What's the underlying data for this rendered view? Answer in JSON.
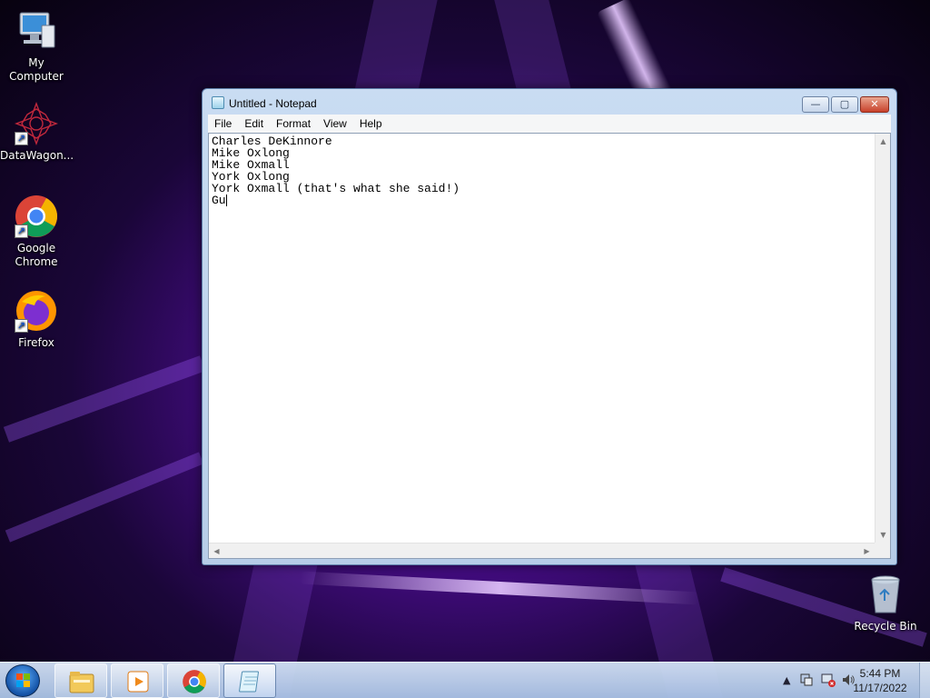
{
  "desktop": {
    "icons": [
      {
        "label": "My Computer",
        "icon": "computer-icon"
      },
      {
        "label": "DataWagon...",
        "icon": "datawagon-icon"
      },
      {
        "label": "Google Chrome",
        "icon": "chrome-icon"
      },
      {
        "label": "Firefox",
        "icon": "firefox-icon"
      },
      {
        "label": "Recycle Bin",
        "icon": "recycle-bin-icon"
      }
    ]
  },
  "notepad": {
    "title": "Untitled - Notepad",
    "menu": [
      "File",
      "Edit",
      "Format",
      "View",
      "Help"
    ],
    "lines": [
      "Charles DeKinnore",
      "Mike Oxlong",
      "Mike Oxmall",
      "York Oxlong",
      "York Oxmall (that's what she said!)",
      "Gu"
    ],
    "controls": {
      "minimize": "—",
      "maximize": "▢",
      "close": "✕"
    }
  },
  "taskbar": {
    "pinned": [
      "explorer-icon",
      "media-player-icon",
      "chrome-icon",
      "notepad-icon"
    ],
    "active": "notepad-icon",
    "tray": {
      "show_hidden": "▲",
      "time": "5:44 PM",
      "date": "11/17/2022"
    }
  },
  "colors": {
    "accent": "#1452a6",
    "close_red": "#c8412b",
    "wallpaper_purple": "#8a2be2"
  }
}
